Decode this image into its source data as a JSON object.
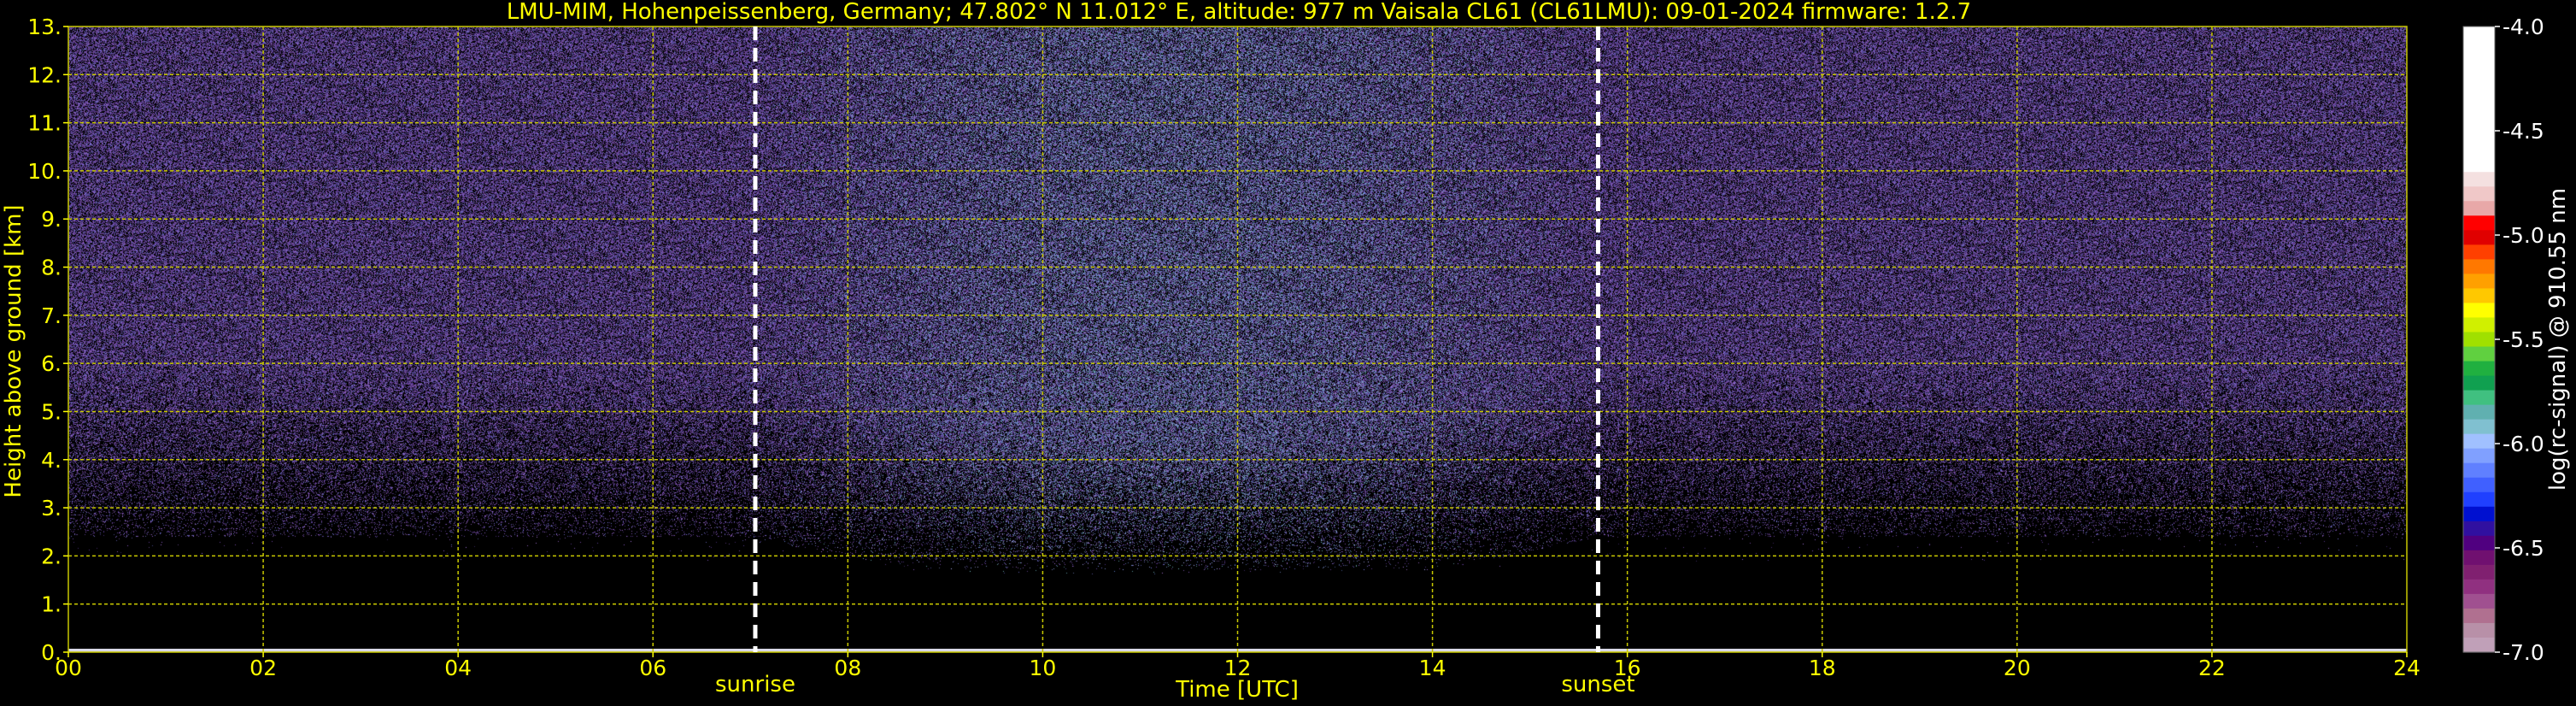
{
  "chart_data": {
    "type": "heatmap",
    "title": "LMU-MIM, Hohenpeissenberg, Germany; 47.802° N 11.012° E, altitude: 977 m    Vaisala CL61 (CL61LMU): 09-01-2024    firmware: 1.2.7",
    "xlabel": "Time [UTC]",
    "ylabel": "Height above ground [km]",
    "xlim": [
      0,
      24
    ],
    "ylim": [
      0,
      13
    ],
    "x_ticks": [
      "00",
      "02",
      "04",
      "06",
      "08",
      "10",
      "12",
      "14",
      "16",
      "18",
      "20",
      "22",
      "24"
    ],
    "y_ticks": [
      "0.",
      "1.",
      "2.",
      "3.",
      "4.",
      "5.",
      "6.",
      "7.",
      "8.",
      "9.",
      "10.",
      "11.",
      "12.",
      "13."
    ],
    "grid": true,
    "annotations": [
      {
        "label": "sunrise",
        "x": 7.05
      },
      {
        "label": "sunset",
        "x": 15.7
      }
    ],
    "colorbar": {
      "label": "log(rc-signal) @ 910.55 nm",
      "range": [
        -7.0,
        -4.0
      ],
      "ticks": [
        "-4.0",
        "-4.5",
        "-5.0",
        "-5.5",
        "-6.0",
        "-6.5",
        "-7.0"
      ]
    }
  },
  "colors": {
    "text": "#ffff00",
    "grid": "#c8c800",
    "background": "#000000",
    "colorbar_text": "#ffffff"
  }
}
